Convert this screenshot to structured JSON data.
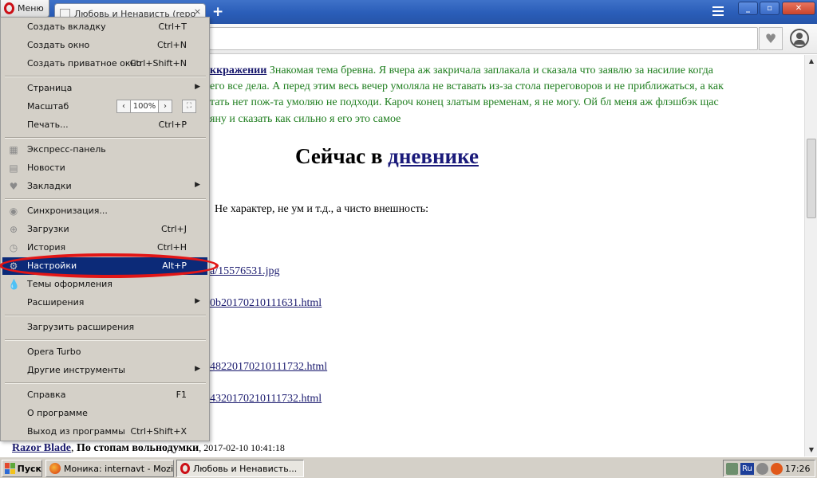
{
  "browser": {
    "menu_label": "Меню",
    "tab_title": "Любовь и Ненависть (repo",
    "tab_close": "×",
    "new_tab": "+"
  },
  "page": {
    "green_link": "ккражении",
    "green_line1": "Знакомая тема бревна. Я вчера аж закричала заплакала и сказала что заявлю за насилие когда",
    "green_line2": "его все дела. А перед этим весь вечер умоляла не вставать из-за стола переговоров и не приближаться, а как",
    "green_line3": "тать нет пож-та умоляю не подходи. Кароч конец златым временам, я не могу. Ой бл меня аж флэшбэк щас",
    "green_line4": "яну и сказать как сильно я его это самое",
    "heading_prefix": "Сейчас в",
    "heading_link": "дневнике",
    "plain_text": "Не характер, не ум и т.д., а чисто внешность:",
    "link1": "a/15576531.jpg",
    "link2": "0b20170210111631.html",
    "link3": "48220170210111732.html",
    "link4": "4320170210111732.html",
    "footer_author": "Razor Blade",
    "footer_sep": ",",
    "footer_post": "По стопам вольнодумки",
    "footer_date": ", 2017-02-10 10:41:18"
  },
  "menu": {
    "new_tab": "Создать вкладку",
    "new_tab_sc": "Ctrl+T",
    "new_window": "Создать окно",
    "new_window_sc": "Ctrl+N",
    "new_private": "Создать приватное окно",
    "new_private_sc": "Ctrl+Shift+N",
    "page": "Страница",
    "zoom": "Масштаб",
    "zoom_value": "100%",
    "print": "Печать...",
    "print_sc": "Ctrl+P",
    "speed_dial": "Экспресс-панель",
    "news": "Новости",
    "bookmarks": "Закладки",
    "sync": "Синхронизация...",
    "downloads": "Загрузки",
    "downloads_sc": "Ctrl+J",
    "history": "История",
    "history_sc": "Ctrl+H",
    "settings": "Настройки",
    "settings_sc": "Alt+P",
    "themes": "Темы оформления",
    "extensions": "Расширения",
    "get_extensions": "Загрузить расширения",
    "opera_turbo": "Opera Turbo",
    "other_tools": "Другие инструменты",
    "help": "Справка",
    "help_sc": "F1",
    "about": "О программе",
    "exit": "Выход из программы",
    "exit_sc": "Ctrl+Shift+X",
    "submenu_arrow": "▶",
    "zoom_dec": "‹",
    "zoom_inc": "›",
    "zoom_full": "⛶"
  },
  "taskbar": {
    "start": "Пуск",
    "task1": "Моника: internavt - Mozi...",
    "task2": "Любовь и Ненависть...",
    "lang": "Ru",
    "clock": "17:26"
  },
  "colors": {
    "titlebar": "#2a5db8",
    "menu_bg": "#d4d0c8",
    "menu_selected": "#0c2a78",
    "highlight_ring": "#e21616",
    "opera_red": "#cc0f16",
    "page_green": "#1f7e1f",
    "link_blue": "#1a1a6e"
  },
  "icons": {
    "opera_logo": "opera-logo-icon",
    "heart": "heart-icon",
    "account": "account-icon",
    "speed_dial": "grid-icon",
    "news": "news-icon",
    "bookmarks": "heart-icon",
    "sync": "sync-icon",
    "downloads": "download-icon",
    "history": "clock-icon",
    "settings": "gear-icon",
    "themes": "drop-icon"
  }
}
